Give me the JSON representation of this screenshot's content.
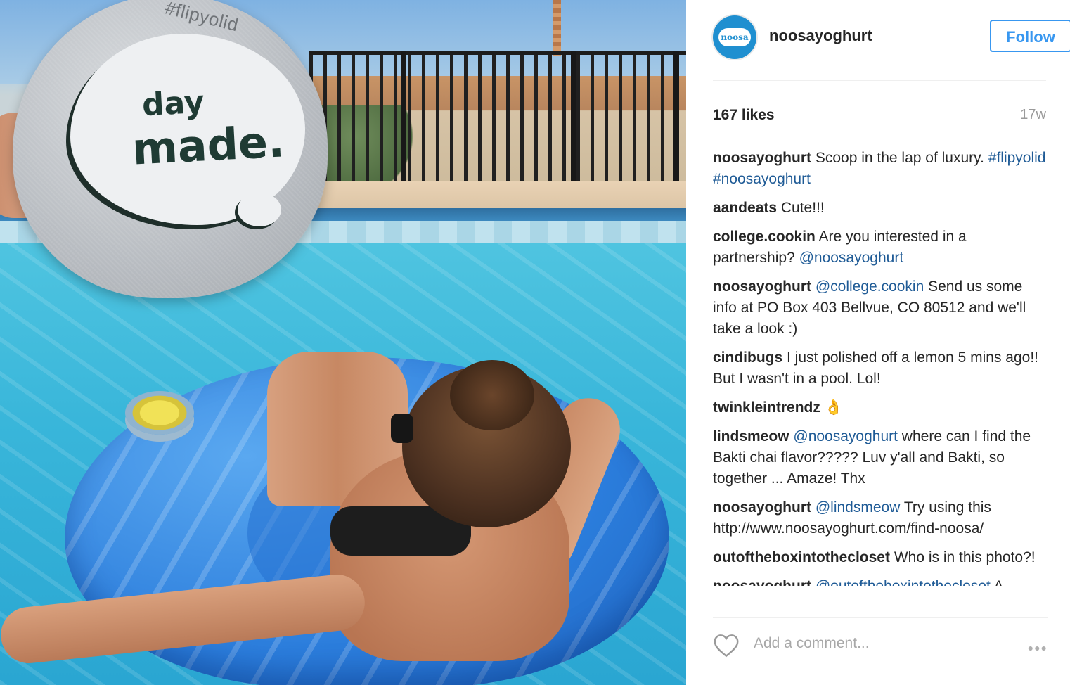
{
  "photo": {
    "lid_hashtag": "#flipyolid",
    "lid_line1": "day",
    "lid_line2": "made."
  },
  "header": {
    "username": "noosayoghurt",
    "avatar_text": "noosa",
    "follow_label": "Follow"
  },
  "stats": {
    "likes": "167 likes",
    "age": "17w"
  },
  "comments": [
    {
      "user": "noosayoghurt",
      "text": " Scoop in the lap of luxury. ",
      "link": "#flipyolid #noosayoghurt",
      "after": ""
    },
    {
      "user": "aandeats",
      "text": " Cute!!!",
      "link": "",
      "after": ""
    },
    {
      "user": "college.cookin",
      "text": " Are you interested in a partnership? ",
      "link": "@noosayoghurt",
      "after": ""
    },
    {
      "user": "noosayoghurt",
      "text": " ",
      "link": "@college.cookin",
      "after": " Send us some info at PO Box 403 Bellvue, CO 80512 and we'll take a look :)"
    },
    {
      "user": "cindibugs",
      "text": " I just polished off a lemon 5 mins ago!! But I wasn't in a pool. Lol!",
      "link": "",
      "after": ""
    },
    {
      "user": "twinkleintrendz",
      "text": " 👌",
      "link": "",
      "after": ""
    },
    {
      "user": "lindsmeow",
      "text": " ",
      "link": "@noosayoghurt",
      "after": " where can I find the Bakti chai flavor????? Luv y'all and Bakti, so together ... Amaze! Thx"
    },
    {
      "user": "noosayoghurt",
      "text": " ",
      "link": "@lindsmeow",
      "after": " Try using this http://www.noosayoghurt.com/find-noosa/"
    },
    {
      "user": "outoftheboxintothecloset",
      "text": " Who is in this photo?!",
      "link": "",
      "after": ""
    },
    {
      "user": "noosayoghurt",
      "text": " ",
      "link": "@outoftheboxintothecloset",
      "after": " A"
    }
  ],
  "footer": {
    "add_comment_placeholder": "Add a comment...",
    "more_label": "●●●"
  },
  "colors": {
    "follow_blue": "#3897f0",
    "link_blue": "#1f5b96",
    "avatar_blue": "#1f8fd0"
  },
  "icons": [
    "heart-icon",
    "more-options-icon"
  ]
}
